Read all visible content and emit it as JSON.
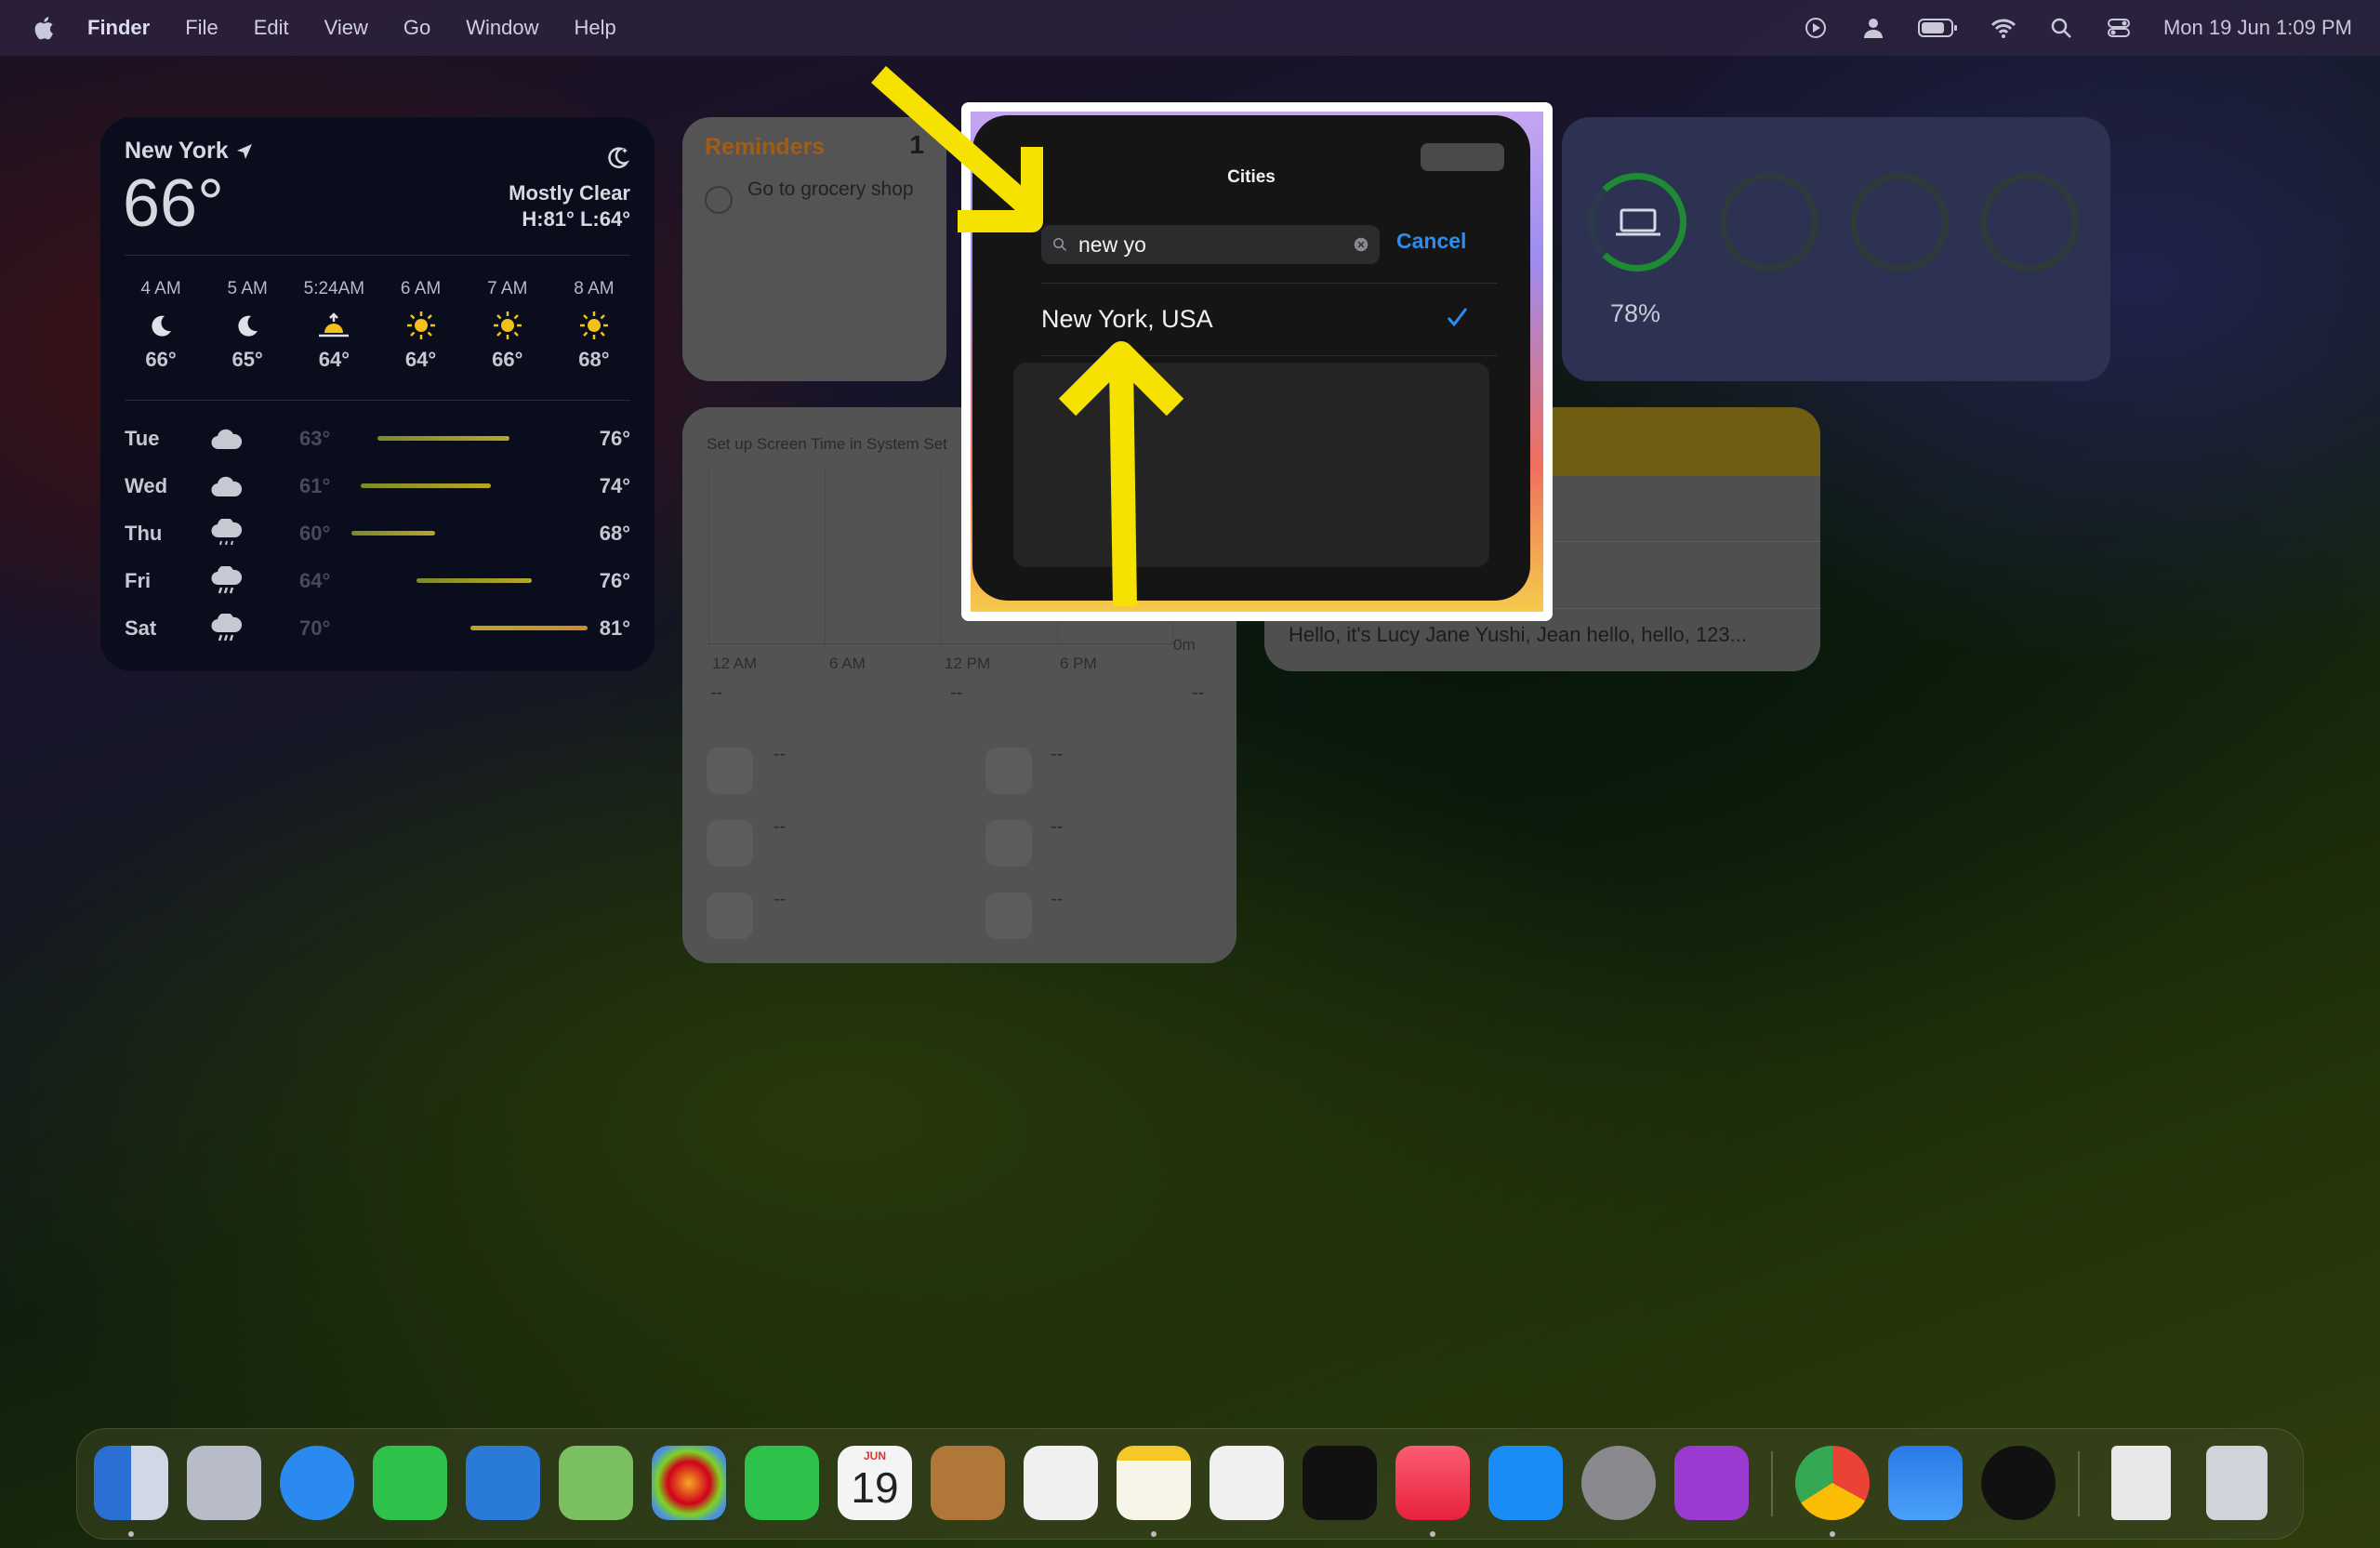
{
  "menubar": {
    "app_name": "Finder",
    "menus": [
      "File",
      "Edit",
      "View",
      "Go",
      "Window",
      "Help"
    ],
    "clock": "Mon 19 Jun  1:09 PM"
  },
  "weather": {
    "city": "New York",
    "temp": "66°",
    "condition": "Mostly Clear",
    "hilo": "H:81° L:64°",
    "hourly": [
      {
        "time": "4 AM",
        "icon": "moon-icon",
        "temp": "66°"
      },
      {
        "time": "5 AM",
        "icon": "moon-icon",
        "temp": "65°"
      },
      {
        "time": "5:24AM",
        "icon": "sunrise-icon",
        "temp": "64°"
      },
      {
        "time": "6 AM",
        "icon": "sun-icon",
        "temp": "64°"
      },
      {
        "time": "7 AM",
        "icon": "sun-icon",
        "temp": "66°"
      },
      {
        "time": "8 AM",
        "icon": "sun-icon",
        "temp": "68°"
      }
    ],
    "daily": [
      {
        "day": "Tue",
        "icon": "cloud-icon",
        "low": "63°",
        "high": "76°"
      },
      {
        "day": "Wed",
        "icon": "cloud-icon",
        "low": "61°",
        "high": "74°"
      },
      {
        "day": "Thu",
        "icon": "cloud-drizzle-icon",
        "low": "60°",
        "high": "68°"
      },
      {
        "day": "Fri",
        "icon": "cloud-rain-icon",
        "low": "64°",
        "high": "76°"
      },
      {
        "day": "Sat",
        "icon": "cloud-rain-icon",
        "low": "70°",
        "high": "81°"
      }
    ]
  },
  "reminders": {
    "title": "Reminders",
    "count": "1",
    "item": "Go to grocery shop"
  },
  "screentime": {
    "title": "Set up Screen Time in System Set",
    "axis_labels": [
      "12 AM",
      "6 AM",
      "12 PM",
      "6 PM"
    ],
    "zero_label": "0m",
    "dash": "--"
  },
  "battery": {
    "percent": "78%",
    "level": 0.78
  },
  "notes": {
    "preview": "Hello, it's Lucy Jane Yushi, Jean hello, hello, 123..."
  },
  "cities": {
    "title": "Cities",
    "search_value": "new yo",
    "cancel_label": "Cancel",
    "result": "New York, USA"
  },
  "colors": {
    "accent_blue": "#2d8cf0",
    "arrow_yellow": "#f5e200",
    "reminders_orange": "#a25d14",
    "battery_green": "#1e8a33"
  },
  "dock": {
    "apps": [
      "finder-icon",
      "launchpad-icon",
      "safari-icon",
      "messages-icon",
      "mail-icon",
      "maps-icon",
      "photos-icon",
      "facetime-icon",
      "calendar-icon",
      "contacts-icon",
      "reminders-icon",
      "notes-icon",
      "freeform-icon",
      "tv-icon",
      "music-icon",
      "app-store-icon",
      "system-settings-icon",
      "feedback-icon",
      "chrome-icon",
      "weather-icon",
      "clock-icon",
      "document-icon",
      "trash-icon"
    ],
    "calendar_month": "JUN",
    "calendar_day": "19"
  }
}
